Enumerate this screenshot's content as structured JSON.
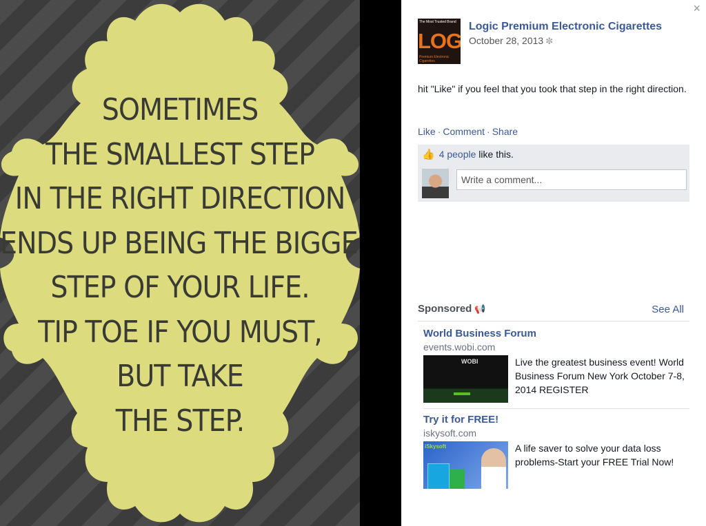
{
  "photo": {
    "quote_lines": [
      "SOMETIMES",
      "THE SMALLEST STEP",
      "IN THE RIGHT DIRECTION",
      "ENDS UP BEING THE BIGGEST",
      "STEP OF YOUR LIFE.",
      "TIP TOE IF YOU MUST,",
      "BUT TAKE",
      "THE STEP."
    ],
    "colors": {
      "frame": "#dcdc7e",
      "text": "#3a3a35",
      "stripes": "#444444"
    }
  },
  "side": {
    "close_label": "×",
    "page": {
      "logo_word": "LOGIC",
      "logo_top_text": "The Most Trusted Brand",
      "logo_bottom_text": "Premium Electronic Cigarettes",
      "name": "Logic Premium Electronic Cigarettes",
      "date": "October 28, 2013",
      "audience_icon": "✼"
    },
    "post_text": "hit \"Like\" if you feel that you took that step in the right direction.",
    "actions": {
      "like": "Like",
      "comment": "Comment",
      "share": "Share",
      "separator": "·"
    },
    "likes": {
      "thumb_icon": "👍",
      "count": "4 people",
      "suffix": "like this."
    },
    "comment": {
      "placeholder": "Write a comment..."
    },
    "sponsored": {
      "title": "Sponsored",
      "icon": "📢",
      "see_all": "See All",
      "ads": [
        {
          "title": "World Business Forum",
          "domain": "events.wobi.com",
          "body": "Live the greatest business event! World Business Forum New York October 7-8, 2014 REGISTER",
          "image_brand": "WOBI"
        },
        {
          "title": "Try it for FREE!",
          "domain": "iskysoft.com",
          "body": "A life saver to solve your data loss problems-Start your FREE Trial Now!",
          "image_brand": "iSkysoft"
        }
      ]
    },
    "colors": {
      "link": "#3b5998",
      "likes_bg": "#e9ebee"
    }
  }
}
